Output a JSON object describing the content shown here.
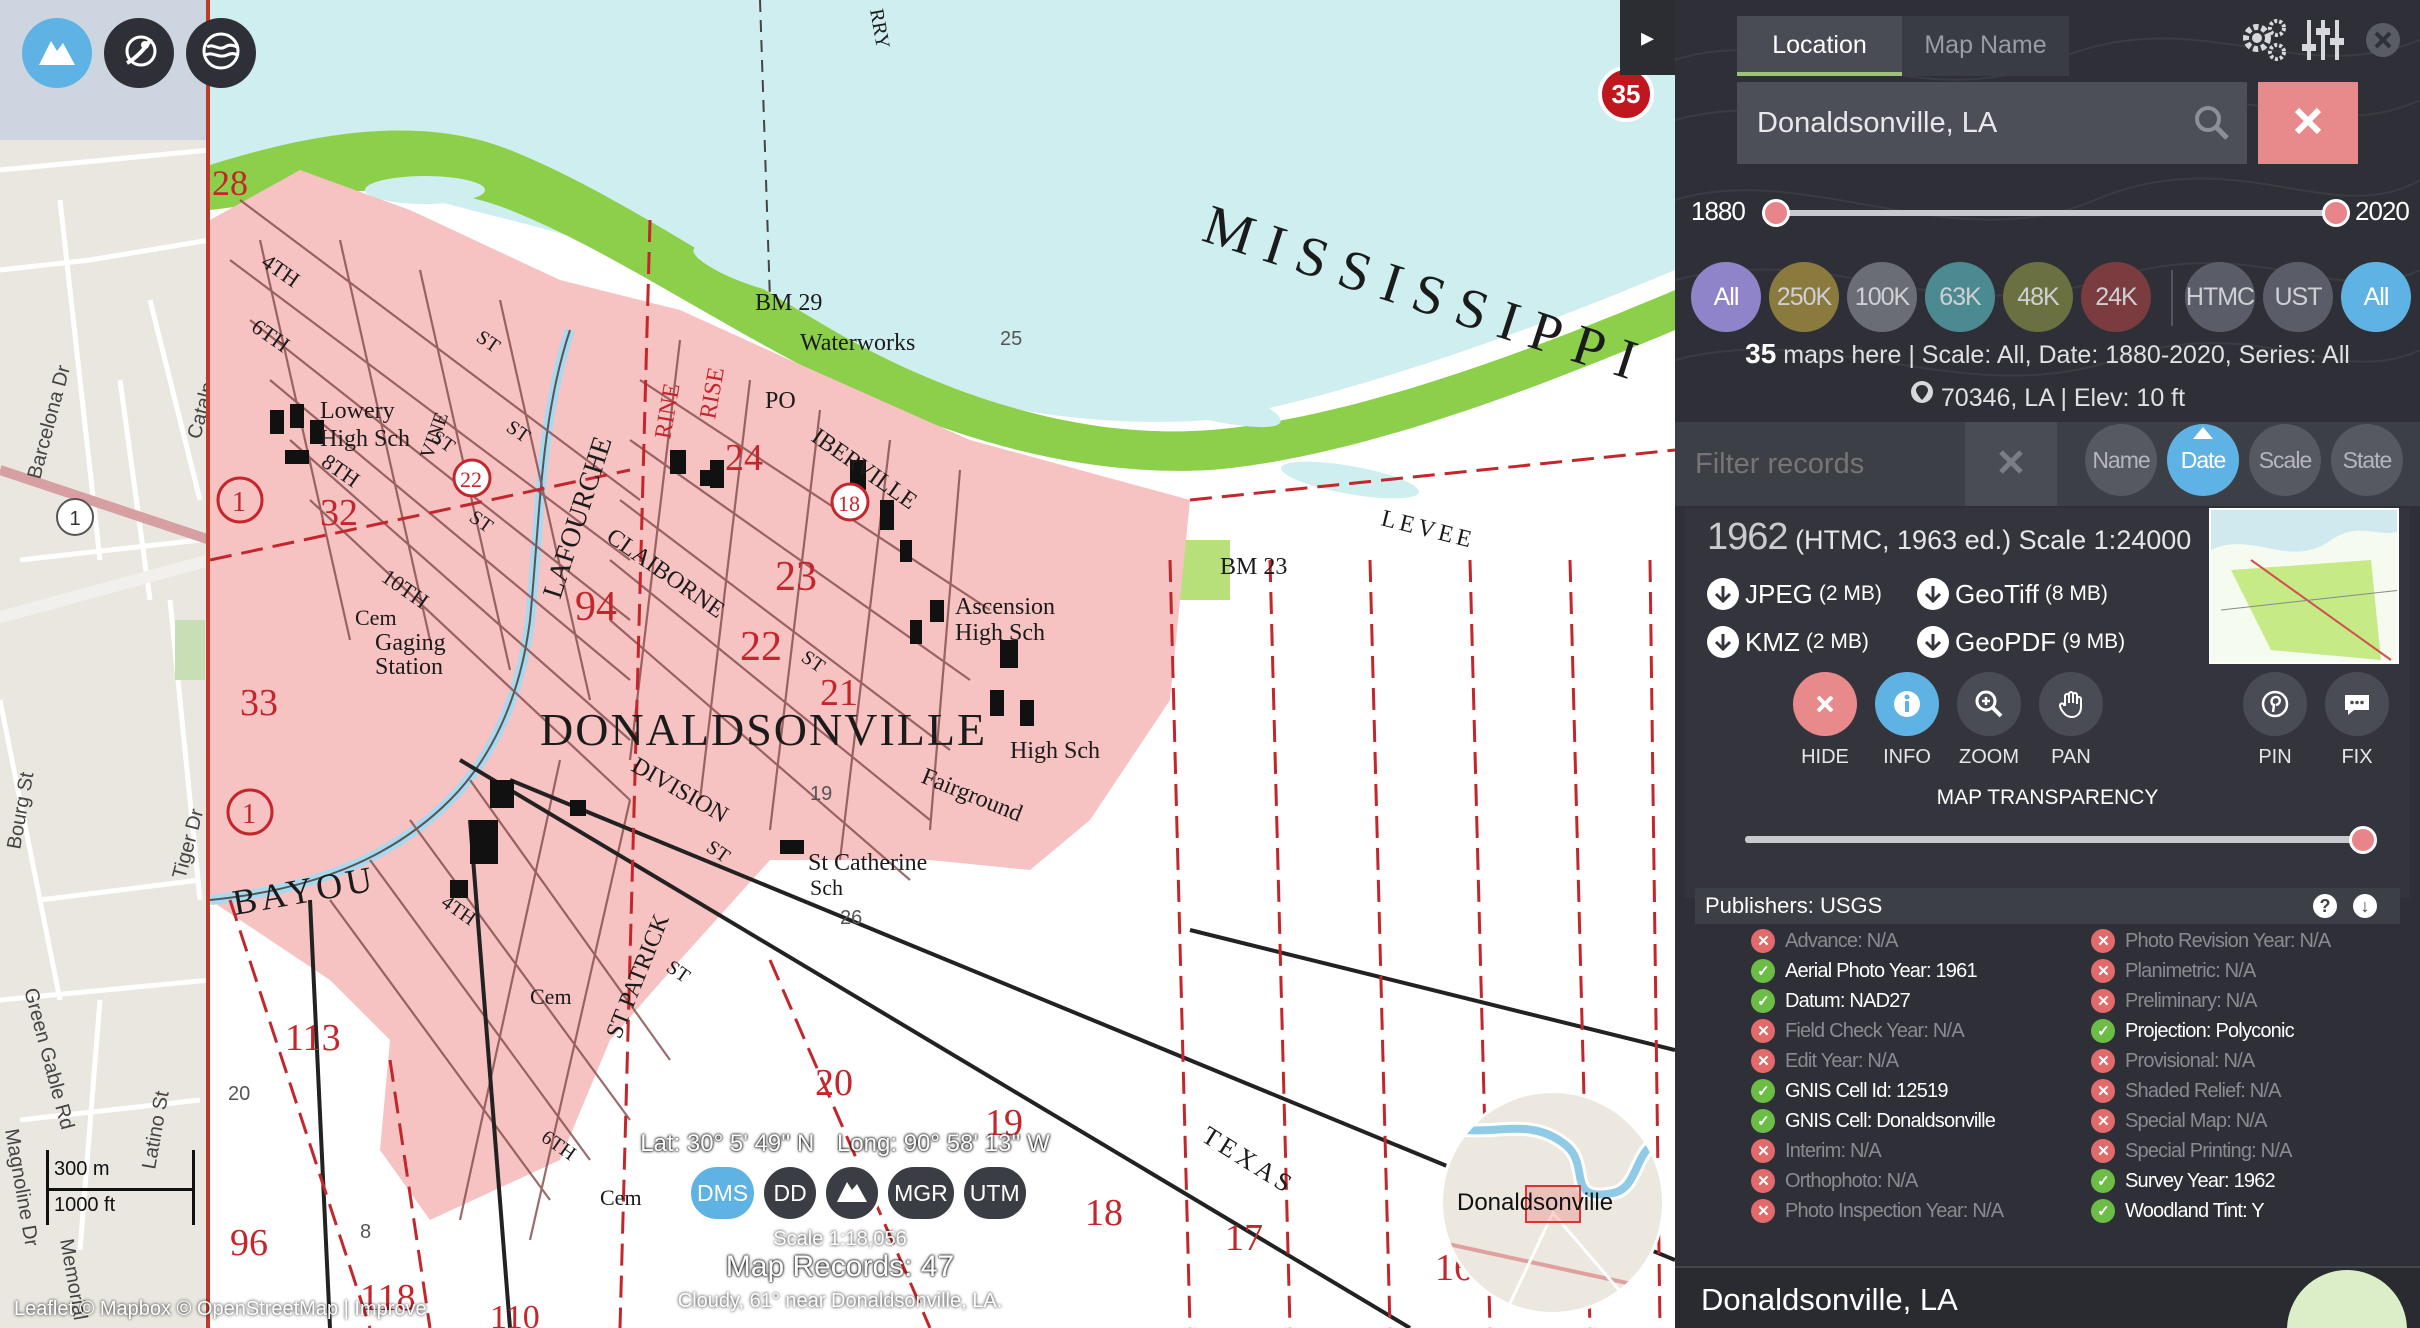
{
  "layers": {
    "topo_icon": "mountain-icon",
    "satellite_icon": "satellite-icon",
    "water_icon": "water-icon"
  },
  "street_map": {
    "roads": [
      "Barcelona Dr",
      "Catalpa",
      "Bourg St",
      "Tiger Dr",
      "Green Gable Rd",
      "Latino St",
      "Magnoline Dr",
      "Memorial"
    ],
    "route_shield": "1"
  },
  "topo_map": {
    "labels": {
      "river": "MISSISSIPPI",
      "town": "DONALDSONVILLE",
      "bayou": "BAYOU",
      "lafourche": "LAFOURCHE",
      "claiborne": "CLAIBORNE",
      "division": "DIVISION",
      "iberville": "IBERVILLE",
      "st_patrick": "ST PATRICK",
      "texas": "TEXAS",
      "levee": "LEVEE",
      "waterworks": "Waterworks",
      "bm29": "BM 29",
      "bm23": "BM 23",
      "po": "PO",
      "rine": "RINE",
      "rise": "RISE",
      "lowery": "Lowery",
      "high_sch": "High Sch",
      "ascension": "Ascension",
      "ascension_hs": "High Sch",
      "high_sch2": "High Sch",
      "fairground": "Fairground",
      "st_catherine": "St Catherine",
      "sch": "Sch",
      "gaging": "Gaging",
      "station": "Station",
      "cem1": "Cem",
      "cem2": "Cem",
      "cem3": "Cem",
      "n28": "28",
      "n32": "32",
      "n33": "33",
      "n94": "94",
      "n22": "22",
      "n23": "23",
      "n24": "24",
      "n21": "21",
      "n20": "20",
      "n19": "19",
      "n18": "18",
      "n17": "17",
      "n16": "16",
      "n96": "96",
      "n113": "113",
      "n118": "118",
      "n110": "110",
      "c1": "1",
      "c18": "18",
      "c22": "22",
      "s25": "25",
      "s26": "26",
      "s19": "19",
      "s20": "20",
      "s8": "8",
      "s4th": "4TH",
      "s6th": "6TH",
      "s8th": "8TH",
      "s10th": "10TH",
      "s4th2": "4TH",
      "s6th2": "6TH",
      "st1": "ST",
      "st2": "ST",
      "st3": "ST",
      "st4": "ST",
      "st5": "ST",
      "st6": "ST",
      "st7": "ST",
      "vine": "VINE",
      "rry": "RRY"
    }
  },
  "badge_count": "35",
  "coords": {
    "lat": "Lat: 30° 5' 49'' N",
    "long": "Long: 90° 58' 13'' W"
  },
  "coord_buttons": [
    "DMS",
    "DD",
    "MGR",
    "UTM"
  ],
  "coord_mountain_icon": "mountain-icon",
  "map_scale": "Scale 1:18,056",
  "map_records": "Map Records: 47",
  "weather": "Cloudy, 61° near Donaldsonville, LA.",
  "attribution": "Leaflet © Mapbox © OpenStreetMap | Improve",
  "scalebar": {
    "metric": "300 m",
    "imperial": "1000 ft"
  },
  "minimap": {
    "label": "Donaldsonville"
  },
  "panel": {
    "tabs": {
      "location": "Location",
      "map_name": "Map Name"
    },
    "icons": {
      "settings": "gear-icon",
      "sliders": "sliders-icon",
      "close": "close-icon"
    },
    "search": {
      "value": "Donaldsonville, LA",
      "icon": "search-icon"
    },
    "year_range": {
      "min": "1880",
      "max": "2020",
      "low": 1880,
      "high": 2020
    },
    "scale_buttons": [
      {
        "label": "All",
        "color": "#8f84c9"
      },
      {
        "label": "250K",
        "color": "#8a7a3e"
      },
      {
        "label": "100K",
        "color": "#6a6d76"
      },
      {
        "label": "63K",
        "color": "#4c8a91"
      },
      {
        "label": "48K",
        "color": "#6b7040"
      },
      {
        "label": "24K",
        "color": "#7a3c3f"
      }
    ],
    "series_buttons": [
      {
        "label": "HTMC",
        "color": "#5a5d68"
      },
      {
        "label": "UST",
        "color": "#5a5d68"
      },
      {
        "label": "All",
        "color": "#5fb3e4"
      }
    ],
    "summary": {
      "count": "35",
      "text": "maps here | Scale: All, Date: 1880-2020, Series: All",
      "location": "70346, LA | Elev: 10 ft"
    },
    "filter": {
      "placeholder": "Filter records"
    },
    "sort_buttons": [
      "Name",
      "Date",
      "Scale",
      "State"
    ],
    "record": {
      "year": "1962",
      "details": "(HTMC, 1963 ed.)  Scale 1:24000",
      "downloads": [
        {
          "name": "JPEG",
          "size": "(2 MB)"
        },
        {
          "name": "GeoTiff",
          "size": "(8 MB)"
        },
        {
          "name": "KMZ",
          "size": "(2 MB)"
        },
        {
          "name": "GeoPDF",
          "size": "(9 MB)"
        }
      ],
      "actions": {
        "hide": "HIDE",
        "info": "INFO",
        "zoom": "ZOOM",
        "pan": "PAN",
        "pin": "PIN",
        "fix": "FIX"
      },
      "transparency_label": "MAP TRANSPARENCY",
      "transparency": 1.0
    },
    "publishers": "Publishers: USGS",
    "metadata_left": [
      {
        "text": "Advance: N/A",
        "ok": false
      },
      {
        "text": "Aerial Photo Year: 1961",
        "ok": true
      },
      {
        "text": "Datum: NAD27",
        "ok": true
      },
      {
        "text": "Field Check Year: N/A",
        "ok": false
      },
      {
        "text": "Edit Year: N/A",
        "ok": false
      },
      {
        "text": "GNIS Cell Id: 12519",
        "ok": true
      },
      {
        "text": "GNIS Cell: Donaldsonville",
        "ok": true
      },
      {
        "text": "Interim: N/A",
        "ok": false
      },
      {
        "text": "Orthophoto: N/A",
        "ok": false
      },
      {
        "text": "Photo Inspection Year: N/A",
        "ok": false
      }
    ],
    "metadata_right": [
      {
        "text": "Photo Revision Year: N/A",
        "ok": false
      },
      {
        "text": "Planimetric: N/A",
        "ok": false
      },
      {
        "text": "Preliminary: N/A",
        "ok": false
      },
      {
        "text": "Projection: Polyconic",
        "ok": true
      },
      {
        "text": "Provisional: N/A",
        "ok": false
      },
      {
        "text": "Shaded Relief: N/A",
        "ok": false
      },
      {
        "text": "Special Map: N/A",
        "ok": false
      },
      {
        "text": "Special Printing: N/A",
        "ok": false
      },
      {
        "text": "Survey Year: 1962",
        "ok": true
      },
      {
        "text": "Woodland Tint: Y",
        "ok": true
      }
    ],
    "next_record": "Donaldsonville, LA"
  }
}
